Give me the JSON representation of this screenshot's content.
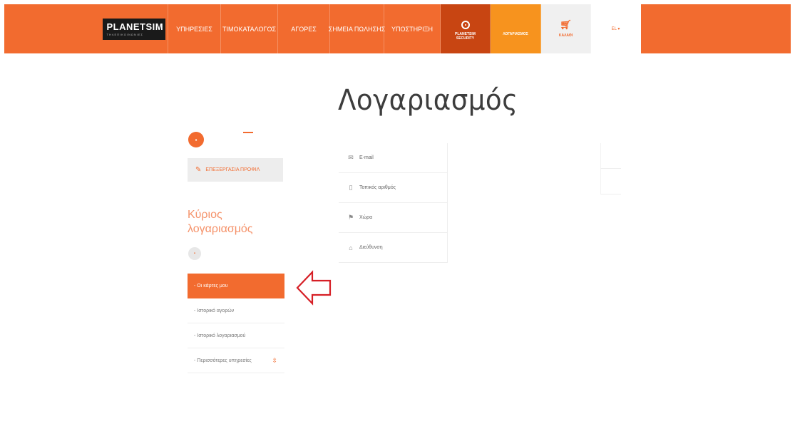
{
  "header": {
    "logo_text_a": "PLANET",
    "logo_text_b": "SIM",
    "logo_tagline": "ΤΗΛΕΠΙΚΟΙΝΩΝΙΕΣ",
    "nav": [
      "ΥΠΗΡΕΣΙΕΣ",
      "ΤΙΜΟΚΑΤΑΛΟΓΟΣ",
      "ΑΓΟΡΕΣ",
      "ΣΗΜΕΙΑ ΠΩΛΗΣΗΣ",
      "ΥΠΟΣΤΗΡΙΞΗ"
    ],
    "security_label_1": "PLANETSIM",
    "security_label_2": "SECURITY",
    "login_label": "ΛΟΓΑΡΙΑΣΜΟΣ",
    "cart_label": "ΚΑΛΑΘΙ",
    "lang_label": "EL ▾"
  },
  "page": {
    "title": "Λογαριασμός"
  },
  "sidebar": {
    "edit_profile_label": "ΕΠΕΞΕΡΓΑΣΙΑ ΠΡΟΦΙΛ",
    "main_account_title": "Κύριος λογαριασμός",
    "menu": [
      "- Οι κάρτες μου",
      "- Ιστορικό αγορών",
      "- Ιστορικό λογαριασμού",
      "- Περισσότερες υπηρεσίες"
    ]
  },
  "info": {
    "rows": [
      "E-mail",
      "Τοπικός αριθμός",
      "Χώρα",
      "Διεύθυνση"
    ]
  },
  "colors": {
    "brand_orange": "#f26b2f",
    "security_dark": "#c84512",
    "login_orange": "#f7931e",
    "annotation_red": "#d61f26"
  }
}
